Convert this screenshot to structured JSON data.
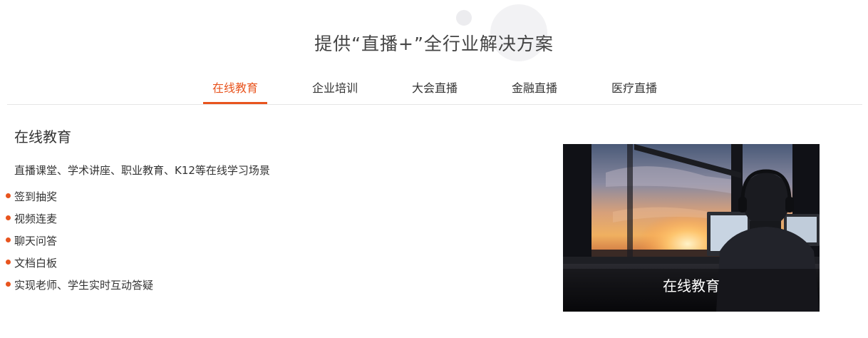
{
  "section": {
    "title": "提供“直播+”全行业解决方案"
  },
  "tabs": [
    {
      "label": "在线教育",
      "active": true
    },
    {
      "label": "企业培训",
      "active": false
    },
    {
      "label": "大会直播",
      "active": false
    },
    {
      "label": "金融直播",
      "active": false
    },
    {
      "label": "医疗直播",
      "active": false
    }
  ],
  "panel": {
    "heading": "在线教育",
    "description": "直播课堂、学术讲座、职业教育、K12等在线学习场景",
    "features": [
      "签到抽奖",
      "视频连麦",
      "聊天问答",
      "文档白板",
      "实现老师、学生实时互动答疑"
    ],
    "image_caption": "在线教育"
  },
  "colors": {
    "accent": "#e8541e",
    "text": "#333333",
    "divider": "#e6e6e6"
  }
}
